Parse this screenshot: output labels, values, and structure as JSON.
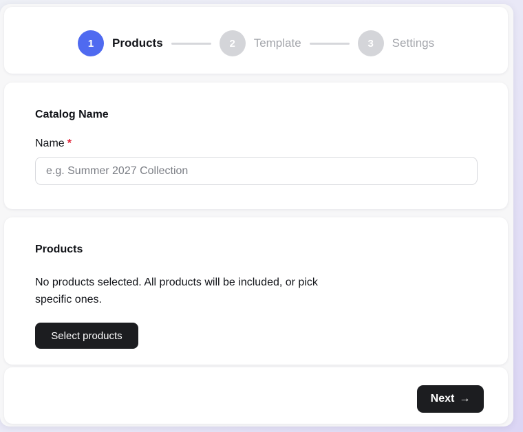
{
  "stepper": {
    "steps": [
      {
        "number": "1",
        "label": "Products",
        "state": "active"
      },
      {
        "number": "2",
        "label": "Template",
        "state": "inactive"
      },
      {
        "number": "3",
        "label": "Settings",
        "state": "inactive"
      }
    ]
  },
  "catalog": {
    "title": "Catalog Name",
    "name_label": "Name",
    "required_mark": "*",
    "name_placeholder": "e.g. Summer 2027 Collection",
    "name_value": ""
  },
  "products": {
    "title": "Products",
    "description": "No products selected. All products will be included, or pick specific ones.",
    "select_button": "Select products"
  },
  "footer": {
    "next_label": "Next",
    "next_icon": "arrow-right-icon"
  },
  "colors": {
    "accent": "#4f6af0",
    "inactive_step": "#d4d5d9",
    "button_dark": "#1c1d20",
    "required": "#e0253a"
  }
}
